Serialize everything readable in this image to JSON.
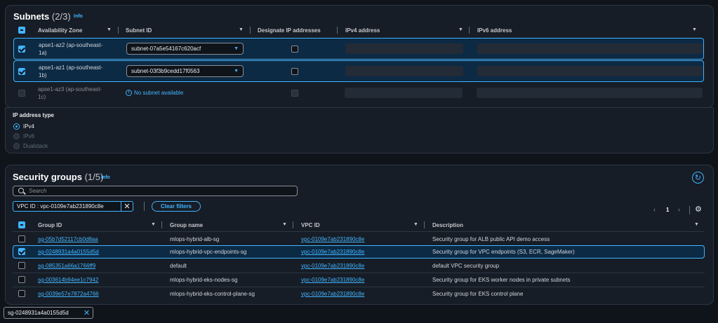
{
  "subnets": {
    "title": "Subnets",
    "count": "(2/3)",
    "info": "Info",
    "columns": [
      "Availability Zone",
      "Subnet ID",
      "Designate IP addresses",
      "IPv4 address",
      "IPv6 address"
    ],
    "rows": [
      {
        "az_line1": "apse1-az2 (ap-southeast-",
        "az_line2": "1a)",
        "subnet": "subnet-07a5e54167c620acf",
        "checked": true
      },
      {
        "az_line1": "apse1-az1 (ap-southeast-",
        "az_line2": "1b)",
        "subnet": "subnet-03f3b9cedd17f0563",
        "checked": true
      },
      {
        "az_line1": "apse1-az3 (ap-southeast-",
        "az_line2": "1c)",
        "subnet": "No subnet available",
        "checked": false
      }
    ]
  },
  "ip_type": {
    "label": "IP address type",
    "options": [
      "IPv4",
      "IPv6",
      "Dualstack"
    ],
    "selected": "IPv4"
  },
  "security_groups": {
    "title": "Security groups",
    "count": "(1/5)",
    "info": "Info",
    "search_placeholder": "Search",
    "filter_token": "VPC ID : vpc-0109e7ab231890c8e",
    "clear_filters": "Clear filters",
    "page": "1",
    "columns": [
      "Group ID",
      "Group name",
      "VPC ID",
      "Description"
    ],
    "rows": [
      {
        "id": "sg-05b7d52117cb0d8aa",
        "name": "mlops-hybrid-alb-sg",
        "vpc": "vpc-0109e7ab231890c8e",
        "desc": "Security group for ALB public API demo access",
        "checked": false
      },
      {
        "id": "sg-0248931a4a0155d5d",
        "name": "mlops-hybrid-vpc-endpoints-sg",
        "vpc": "vpc-0109e7ab231890c8e",
        "desc": "Security group for VPC endpoints (S3, ECR, SageMaker)",
        "checked": true
      },
      {
        "id": "sg-085351a66a1766ff9",
        "name": "default",
        "vpc": "vpc-0109e7ab231890c8e",
        "desc": "default VPC security group",
        "checked": false
      },
      {
        "id": "sg-003614b94ee1c7942",
        "name": "mlops-hybrid-eks-nodes-sg",
        "vpc": "vpc-0109e7ab231890c8e",
        "desc": "Security group for EKS worker nodes in private subnets",
        "checked": false
      },
      {
        "id": "sg-0039e57e7872a4766",
        "name": "mlops-hybrid-eks-control-plane-sg",
        "vpc": "vpc-0109e7ab231890c8e",
        "desc": "Security group for EKS control plane",
        "checked": false
      }
    ],
    "selected_token": "sg-0248931a4a0155d5d"
  },
  "colors": {
    "accent": "#42b4ff",
    "background": "#0f141a",
    "panel": "#161d26"
  }
}
